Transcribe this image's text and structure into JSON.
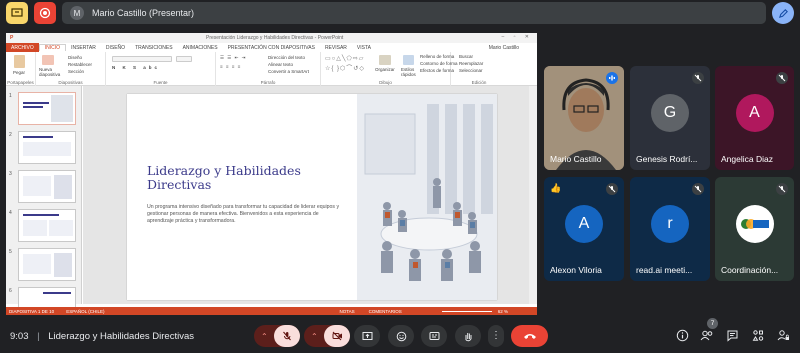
{
  "top": {
    "presenter_initial": "M",
    "presenter_text": "Mario Castillo (Presentar)"
  },
  "ppt": {
    "window_title": "Presentación Liderazgo y Habilidades Directivas - PowerPoint",
    "tabs": [
      "ARCHIVO",
      "INICIO",
      "INSERTAR",
      "DISEÑO",
      "TRANSICIONES",
      "ANIMACIONES",
      "PRESENTACIÓN CON DIAPOSITIVAS",
      "REVISAR",
      "VISTA"
    ],
    "user": "Mario Castillo",
    "ribbon": {
      "portapapeles": "Portapapeles",
      "pegar": "Pegar",
      "nueva_diapositiva": "Nueva diapositiva",
      "diseno": "Diseño",
      "restablecer": "Restablecer",
      "seccion": "Sección",
      "diapositivas": "Diapositivas",
      "fuente": "Fuente",
      "direccion_texto": "Dirección del texto",
      "alinear_texto": "Alinear texto",
      "convertir_smartart": "Convertir a SmartArt",
      "parrafo": "Párrafo",
      "organizar": "Organizar",
      "estilos_rapidos": "Estilos rápidos",
      "relleno_forma": "Relleno de forma",
      "contorno_forma": "Contorno de forma",
      "efectos_forma": "Efectos de forma",
      "dibujo": "Dibujo",
      "buscar": "Buscar",
      "reemplazar": "Reemplazar",
      "seleccionar": "Seleccionar",
      "edicion": "Edición"
    },
    "slide_numbers": [
      "1",
      "2",
      "3",
      "4",
      "5",
      "6"
    ],
    "slide": {
      "title": "Liderazgo y Habilidades Directivas",
      "body": "Un programa intensivo diseñado para transformar tu capacidad de liderar equipos y gestionar personas de manera efectiva. Bienvenidos a esta experiencia de aprendizaje práctica y transformadora."
    },
    "status": {
      "slide_of": "DIAPOSITIVA 1 DE 10",
      "language": "ESPAÑOL (CHILE)",
      "notes": "NOTAS",
      "comments": "COMENTARIOS",
      "zoom": "62 %"
    }
  },
  "participants": [
    {
      "name": "Mario Castillo",
      "initial": "",
      "color": "#3c4043"
    },
    {
      "name": "Genesis Rodrí...",
      "initial": "G",
      "color": "#5f6368"
    },
    {
      "name": "Angelica Diaz",
      "initial": "A",
      "color": "#b0185d"
    },
    {
      "name": "Alexon Viloria",
      "initial": "A",
      "color": "#1565c0"
    },
    {
      "name": "read.ai meeti...",
      "initial": "r",
      "color": "#1565c0"
    },
    {
      "name": "Coordinación...",
      "initial": "",
      "color": "#fff"
    }
  ],
  "bottom": {
    "time": "9:03",
    "separator": "|",
    "meeting_title": "Liderazgo y Habilidades Directivas",
    "participant_count": "7"
  },
  "colors": {
    "ppt_accent": "#d24726",
    "leave_red": "#ea4335",
    "muted_bg": "#f9dedc",
    "tile_bg": "#2c303a"
  }
}
